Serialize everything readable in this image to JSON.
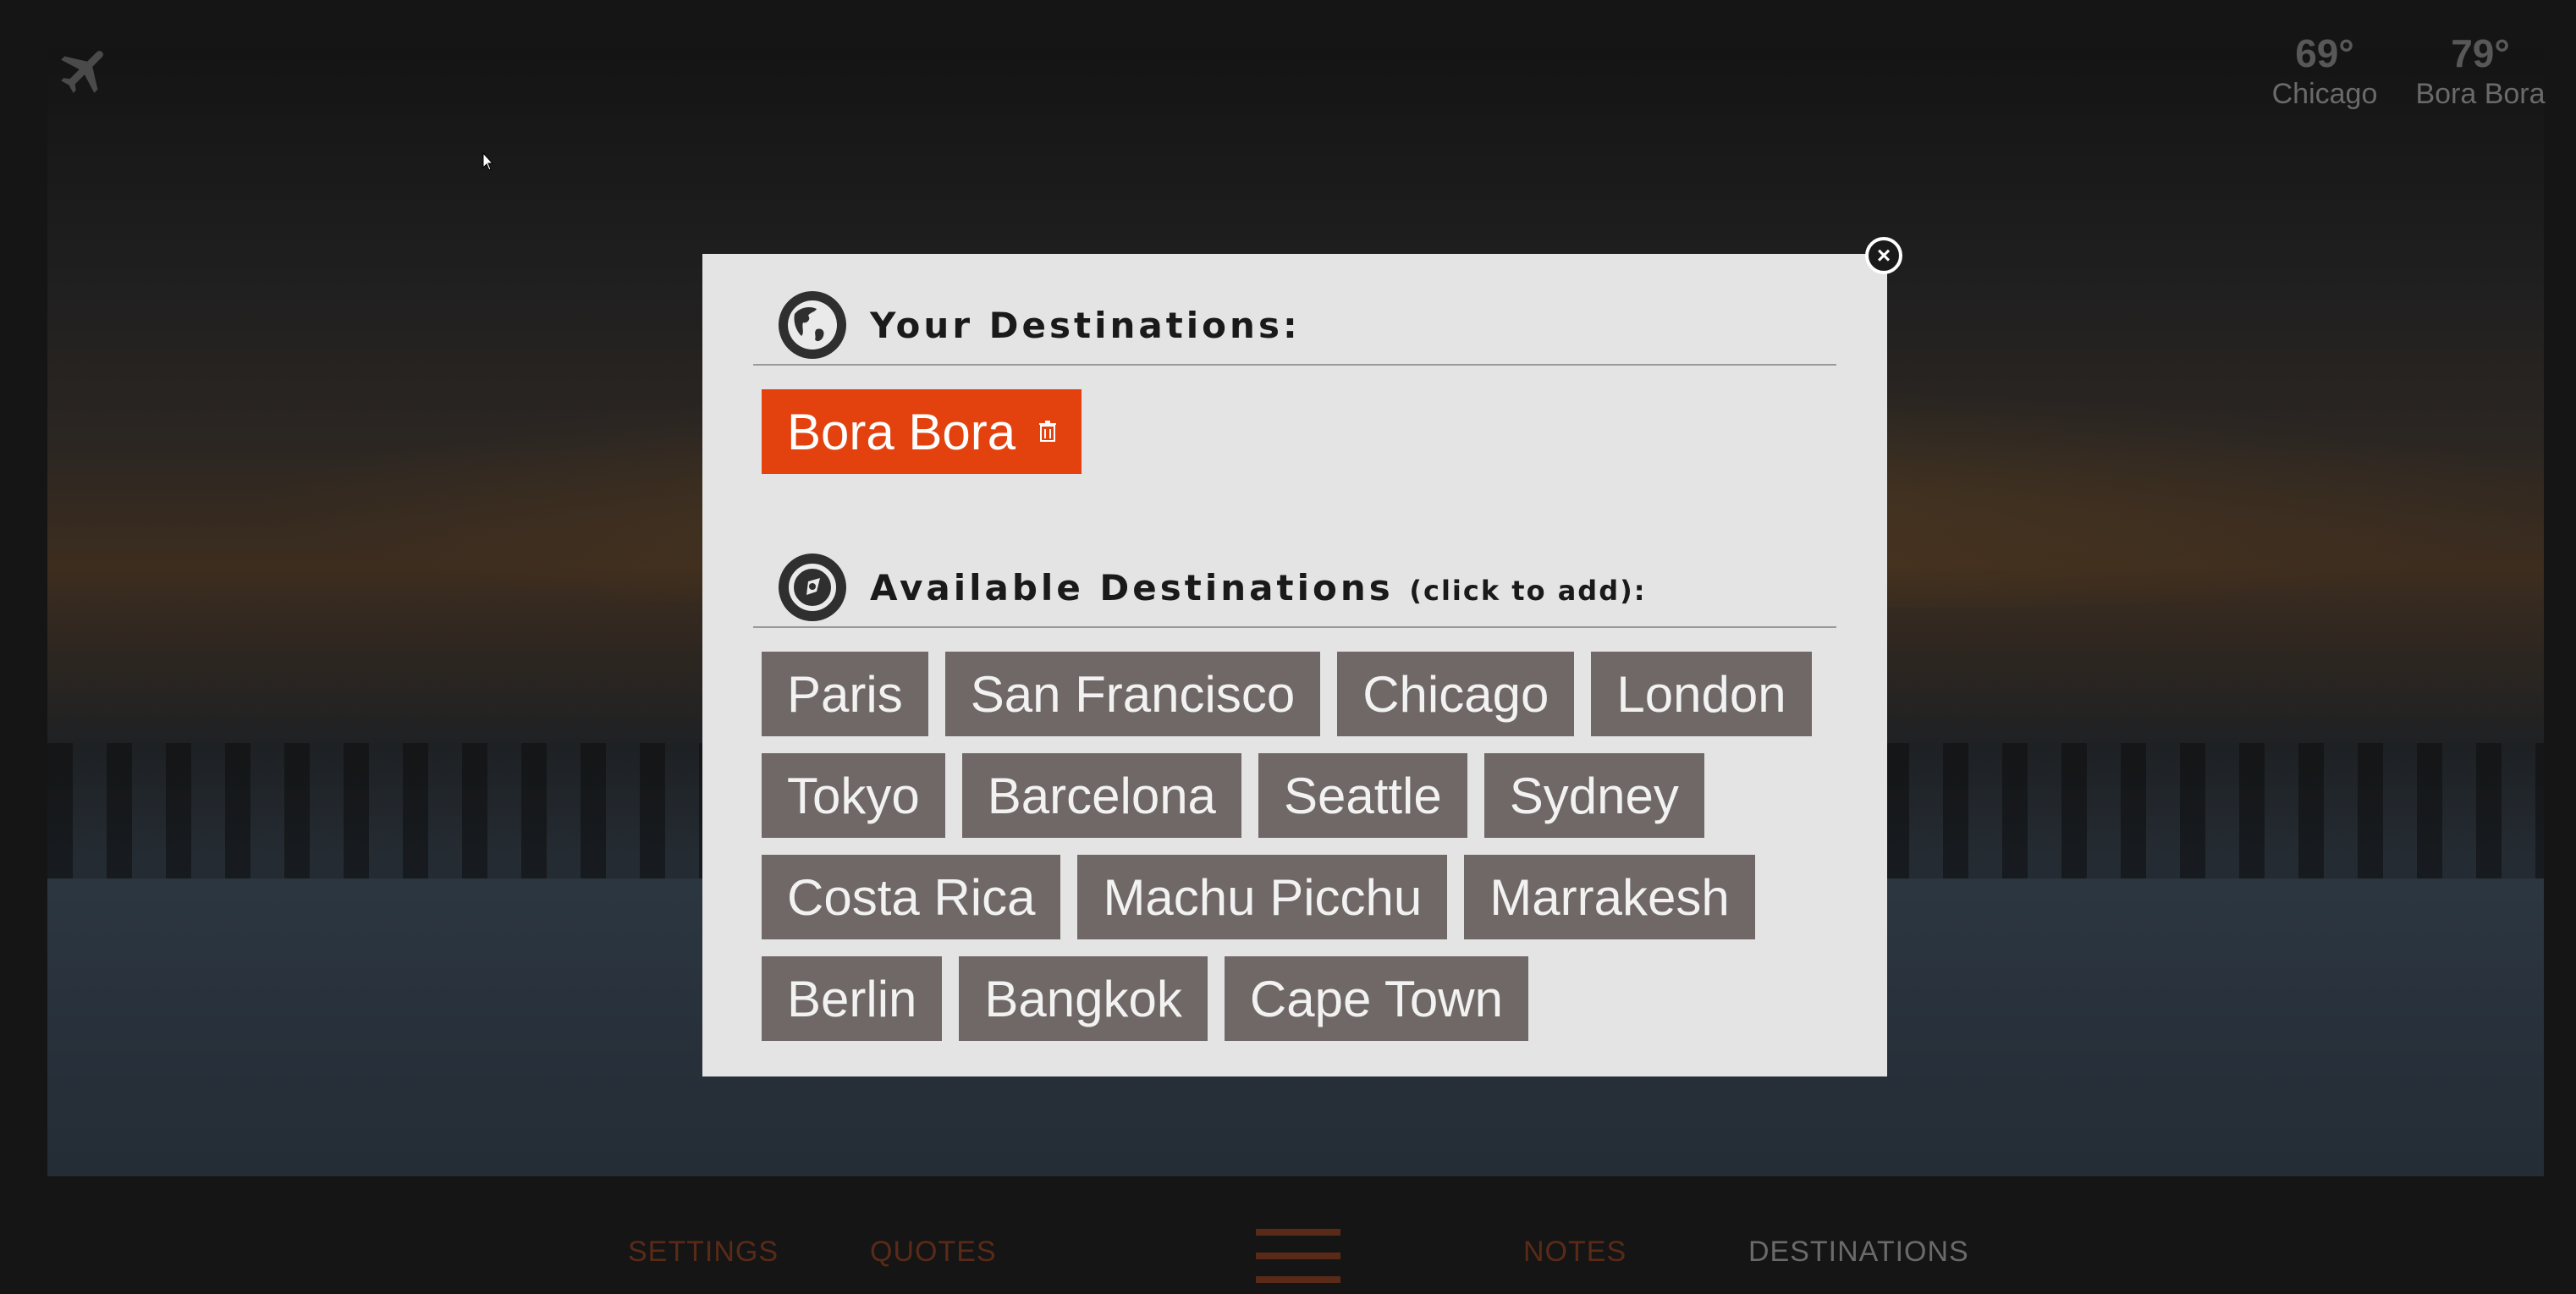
{
  "weather": [
    {
      "temp": "69°",
      "city": "Chicago"
    },
    {
      "temp": "79°",
      "city": "Bora Bora"
    }
  ],
  "modal": {
    "your_title": "Your Destinations:",
    "available_title": "Available Destinations",
    "available_hint": "(click to add):",
    "selected": [
      "Bora Bora"
    ],
    "available": [
      "Paris",
      "San Francisco",
      "Chicago",
      "London",
      "Tokyo",
      "Barcelona",
      "Seattle",
      "Sydney",
      "Costa Rica",
      "Machu Picchu",
      "Marrakesh",
      "Berlin",
      "Bangkok",
      "Cape Town"
    ]
  },
  "nav": {
    "settings": "SETTINGS",
    "quotes": "QUOTES",
    "notes": "NOTES",
    "destinations": "DESTINATIONS"
  },
  "colors": {
    "selected_chip": "#e3420f",
    "available_chip": "#6f6866",
    "modal_bg": "#e4e4e4"
  },
  "icons": [
    "airplane-icon",
    "globe-icon",
    "compass-icon",
    "close-icon",
    "trash-icon",
    "hamburger-menu-icon",
    "cursor-icon"
  ]
}
